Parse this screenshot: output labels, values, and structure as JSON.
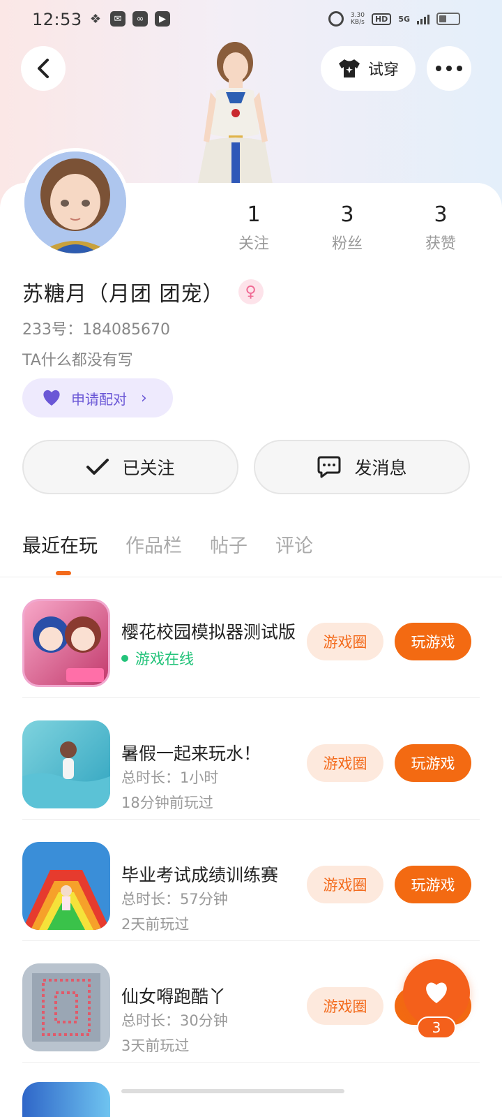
{
  "status_bar": {
    "time": "12:53",
    "speed": "3.30\nKB/s",
    "hd": "HD",
    "network": "5G"
  },
  "header": {
    "back_icon": "chevron-left-icon",
    "tryon_label": "试穿",
    "more_icon": "more-dots-icon"
  },
  "profile": {
    "name": "苏糖月（月团 团宠）",
    "gender_icon": "female-icon",
    "uid": "233号：184085670",
    "bio": "TA什么都没有写",
    "pair_label": "申请配对",
    "stats": [
      {
        "num": "1",
        "label": "关注"
      },
      {
        "num": "3",
        "label": "粉丝"
      },
      {
        "num": "3",
        "label": "获赞"
      }
    ],
    "follow_label": "已关注",
    "message_label": "发消息"
  },
  "tabs": [
    "最近在玩",
    "作品栏",
    "帖子",
    "评论"
  ],
  "games": [
    {
      "title": "樱花校园模拟器测试版",
      "line1": "游戏在线",
      "line2": "",
      "circle": "游戏圈",
      "play": "玩游戏"
    },
    {
      "title": "暑假一起来玩水！",
      "line1": "总时长：1小时",
      "line2": "18分钟前玩过",
      "circle": "游戏圈",
      "play": "玩游戏"
    },
    {
      "title": "毕业考试成绩训练赛",
      "line1": "总时长：57分钟",
      "line2": "2天前玩过",
      "circle": "游戏圈",
      "play": "玩游戏"
    },
    {
      "title": "仙女嘚跑酷丫",
      "line1": "总时长：30分钟",
      "line2": "3天前玩过",
      "circle": "游戏圈",
      "play": "玩游戏"
    }
  ],
  "like": {
    "count": "3"
  },
  "colors": {
    "accent": "#f36a12",
    "online": "#23c37a",
    "pair": "#6a57d6"
  }
}
